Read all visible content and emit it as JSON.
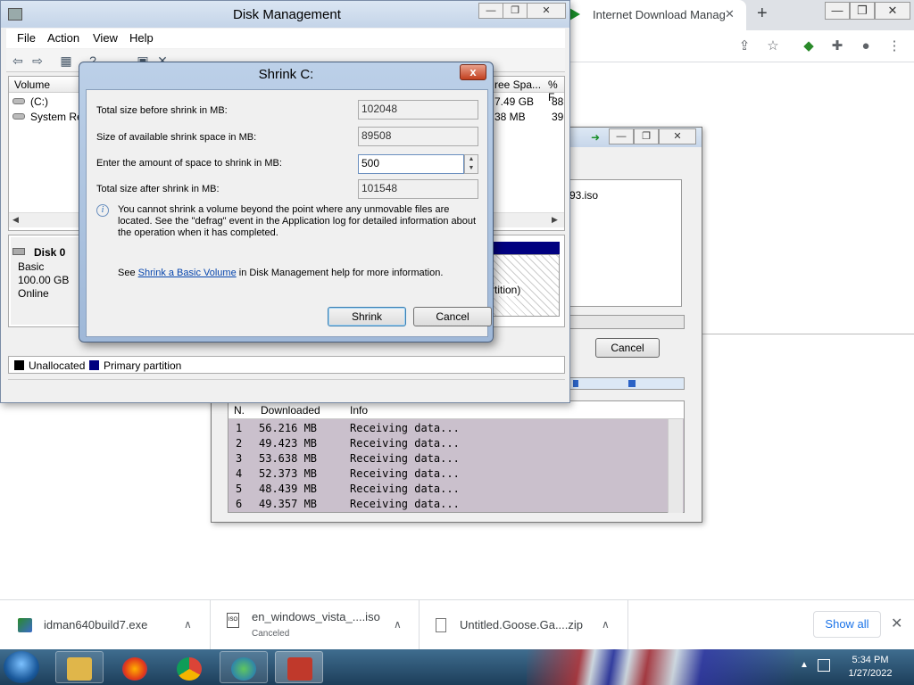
{
  "browser": {
    "tab_title": "Internet Download Manag",
    "tab_close": "✕",
    "new_tab": "+",
    "toolbar_icons": [
      "share-icon",
      "star-icon",
      "idm-extension-icon",
      "puzzle-icon",
      "profile-icon",
      "menu-icon"
    ]
  },
  "disk_mgmt": {
    "title": "Disk Management",
    "menu": [
      "File",
      "Action",
      "View",
      "Help"
    ],
    "columns": [
      "Volume",
      "ree Spa...",
      "% F"
    ],
    "volumes": [
      {
        "name": "(C:)",
        "free": "7.49 GB",
        "pct": "88"
      },
      {
        "name": "System Res",
        "free": "38 MB",
        "pct": "39"
      }
    ],
    "disk": {
      "name": "Disk 0",
      "type": "Basic",
      "size": "100.00 GB",
      "status": "Online"
    },
    "partition_label": "rtition)",
    "legend": [
      {
        "label": "Unallocated",
        "color": "#000000"
      },
      {
        "label": "Primary partition",
        "color": "#000080"
      }
    ]
  },
  "shrink": {
    "title": "Shrink C:",
    "close": "x",
    "fields": [
      {
        "label": "Total size before shrink in MB:",
        "value": "102048"
      },
      {
        "label": "Size of available shrink space in MB:",
        "value": "89508"
      },
      {
        "label": "Enter the amount of space to shrink in MB:",
        "value": "500"
      },
      {
        "label": "Total size after shrink in MB:",
        "value": "101548"
      }
    ],
    "info": "You cannot shrink a volume beyond the point where any unmovable files are located. See the \"defrag\" event in the Application log for detailed information about the operation when it has completed.",
    "see_prefix": "See ",
    "see_link": "Shrink a Basic Volume",
    "see_suffix": " in Disk Management help for more information.",
    "ok": "Shrink",
    "cancel": "Cancel"
  },
  "idm": {
    "filename": "93.iso",
    "cancel": "Cancel",
    "headers": [
      "N.",
      "Downloaded",
      "Info"
    ],
    "rows": [
      {
        "n": "1",
        "dl": "56.216  MB",
        "info": "Receiving data..."
      },
      {
        "n": "2",
        "dl": "49.423  MB",
        "info": "Receiving data..."
      },
      {
        "n": "3",
        "dl": "53.638  MB",
        "info": "Receiving data..."
      },
      {
        "n": "4",
        "dl": "52.373  MB",
        "info": "Receiving data..."
      },
      {
        "n": "5",
        "dl": "48.439  MB",
        "info": "Receiving data..."
      },
      {
        "n": "6",
        "dl": "49.357  MB",
        "info": "Receiving data..."
      }
    ]
  },
  "downloads": [
    {
      "name": "idman640build7.exe",
      "sub": ""
    },
    {
      "name": "en_windows_vista_....iso",
      "sub": "Canceled"
    },
    {
      "name": "Untitled.Goose.Ga....zip",
      "sub": ""
    }
  ],
  "show_all": "Show all",
  "clock": {
    "time": "5:34 PM",
    "date": "1/27/2022"
  }
}
